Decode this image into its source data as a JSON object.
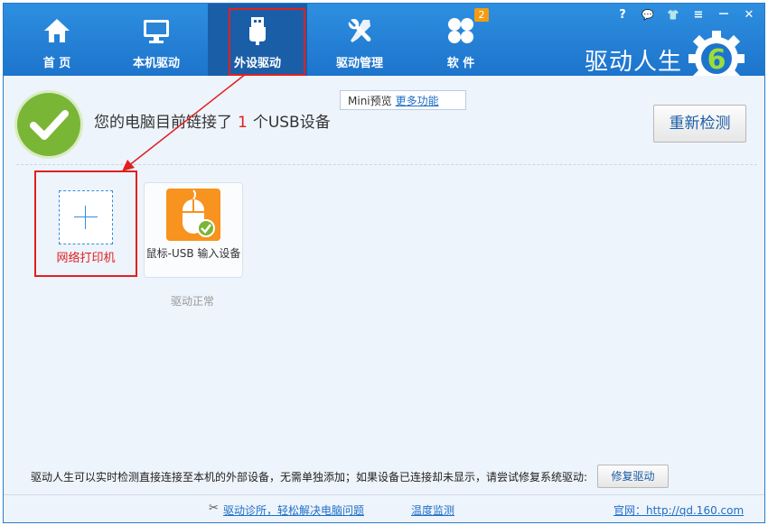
{
  "nav": [
    {
      "label": "首 页",
      "icon": "home-icon"
    },
    {
      "label": "本机驱动",
      "icon": "monitor-icon"
    },
    {
      "label": "外设驱动",
      "icon": "usb-icon"
    },
    {
      "label": "驱动管理",
      "icon": "wrench-icon"
    },
    {
      "label": "软 件",
      "icon": "apps-icon"
    }
  ],
  "badge_count": "2",
  "window_controls": [
    "?",
    "💬",
    "👕",
    "≡",
    "－",
    "✕"
  ],
  "brand": "驱动人生",
  "brand_logo_digit": "6",
  "status": {
    "prefix": "您的电脑目前链接了",
    "count": "1",
    "suffix": "个USB设备"
  },
  "mini_tip": {
    "label": "Mini预览",
    "link": "更多功能"
  },
  "recheck_label": "重新检测",
  "printer_label": "网络打印机",
  "device": {
    "label": "鼠标-USB 输入设备",
    "status": "驱动正常"
  },
  "footer_note": "驱动人生可以实时检测直接连接至本机的外部设备，无需单独添加；如果设备已连接却未显示，请尝试修复系统驱动:",
  "repair_label": "修复驱动",
  "bottom": {
    "diag": "驱动诊所，轻松解决电脑问题",
    "temp": "温度监测",
    "site": "官网：http://qd.160.com"
  },
  "colors": {
    "accent": "#1d74cc",
    "highlight": "#e02020",
    "check": "#7ab636",
    "device_tile": "#f7931e"
  }
}
